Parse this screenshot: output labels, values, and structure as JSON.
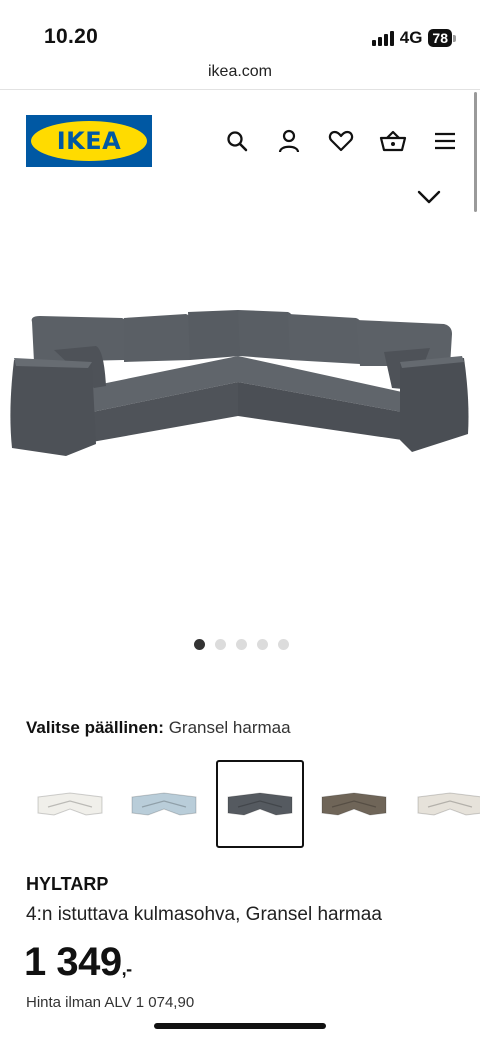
{
  "status_bar": {
    "time": "10.20",
    "network": "4G",
    "battery": "78"
  },
  "browser": {
    "url": "ikea.com"
  },
  "header": {
    "logo_text": "IKEA",
    "icons": [
      "search-icon",
      "user-icon",
      "heart-icon",
      "basket-icon",
      "menu-icon"
    ]
  },
  "gallery": {
    "image_count": 5,
    "active_index": 0
  },
  "cover": {
    "label": "Valitse päällinen:",
    "selected": "Gransel harmaa",
    "swatch_colors": [
      "#f0efea",
      "#b9cdd9",
      "#555a60",
      "#6f6558",
      "#e6e2da"
    ],
    "selected_index": 2
  },
  "product": {
    "name": "HYLTARP",
    "description": "4:n istuttava kulmasohva, Gransel harmaa",
    "price": "1 349",
    "price_suffix": ",-",
    "vat_text": "Hinta ilman ALV 1 074,90"
  },
  "colors": {
    "ikea_blue": "#0058a3",
    "ikea_yellow": "#ffdb00",
    "sofa": "#565b61"
  }
}
